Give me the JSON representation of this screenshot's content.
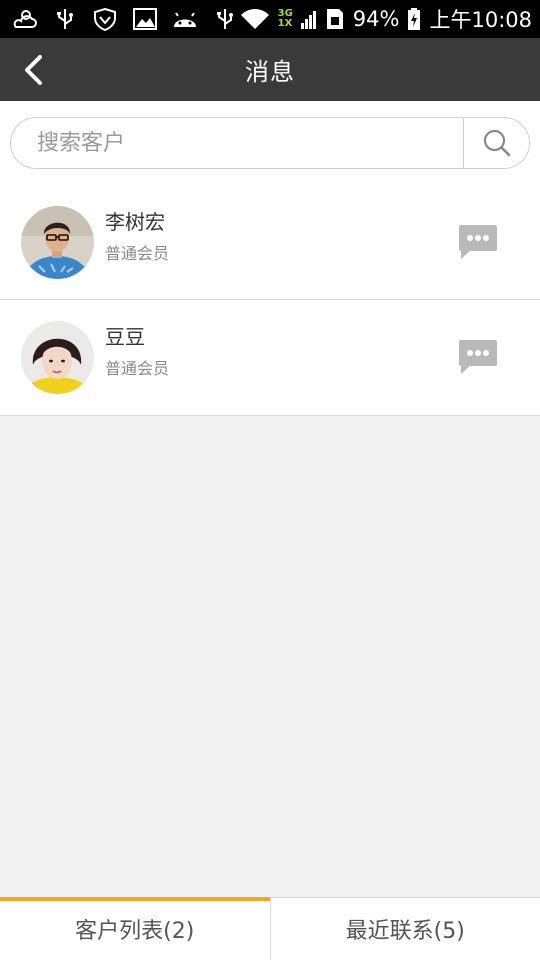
{
  "status_bar": {
    "net_top": "3G",
    "net_bottom": "1X",
    "battery": "94%",
    "time": "上午10:08"
  },
  "header": {
    "title": "消息",
    "back_icon": "chevron-left-icon"
  },
  "search": {
    "placeholder": "搜索客户",
    "value": "",
    "icon": "search-icon"
  },
  "contacts": [
    {
      "name": "李树宏",
      "level": "普通会员",
      "avatar_icon": "avatar-man",
      "action_icon": "chat-bubble-icon"
    },
    {
      "name": "豆豆",
      "level": "普通会员",
      "avatar_icon": "avatar-woman",
      "action_icon": "chat-bubble-icon"
    }
  ],
  "tabs": [
    {
      "label": "客户列表(2)",
      "active": true
    },
    {
      "label": "最近联系(5)",
      "active": false
    }
  ],
  "colors": {
    "header_bg": "#3a3a3a",
    "accent": "#f5a623",
    "page_bg": "#f2f2f2"
  }
}
